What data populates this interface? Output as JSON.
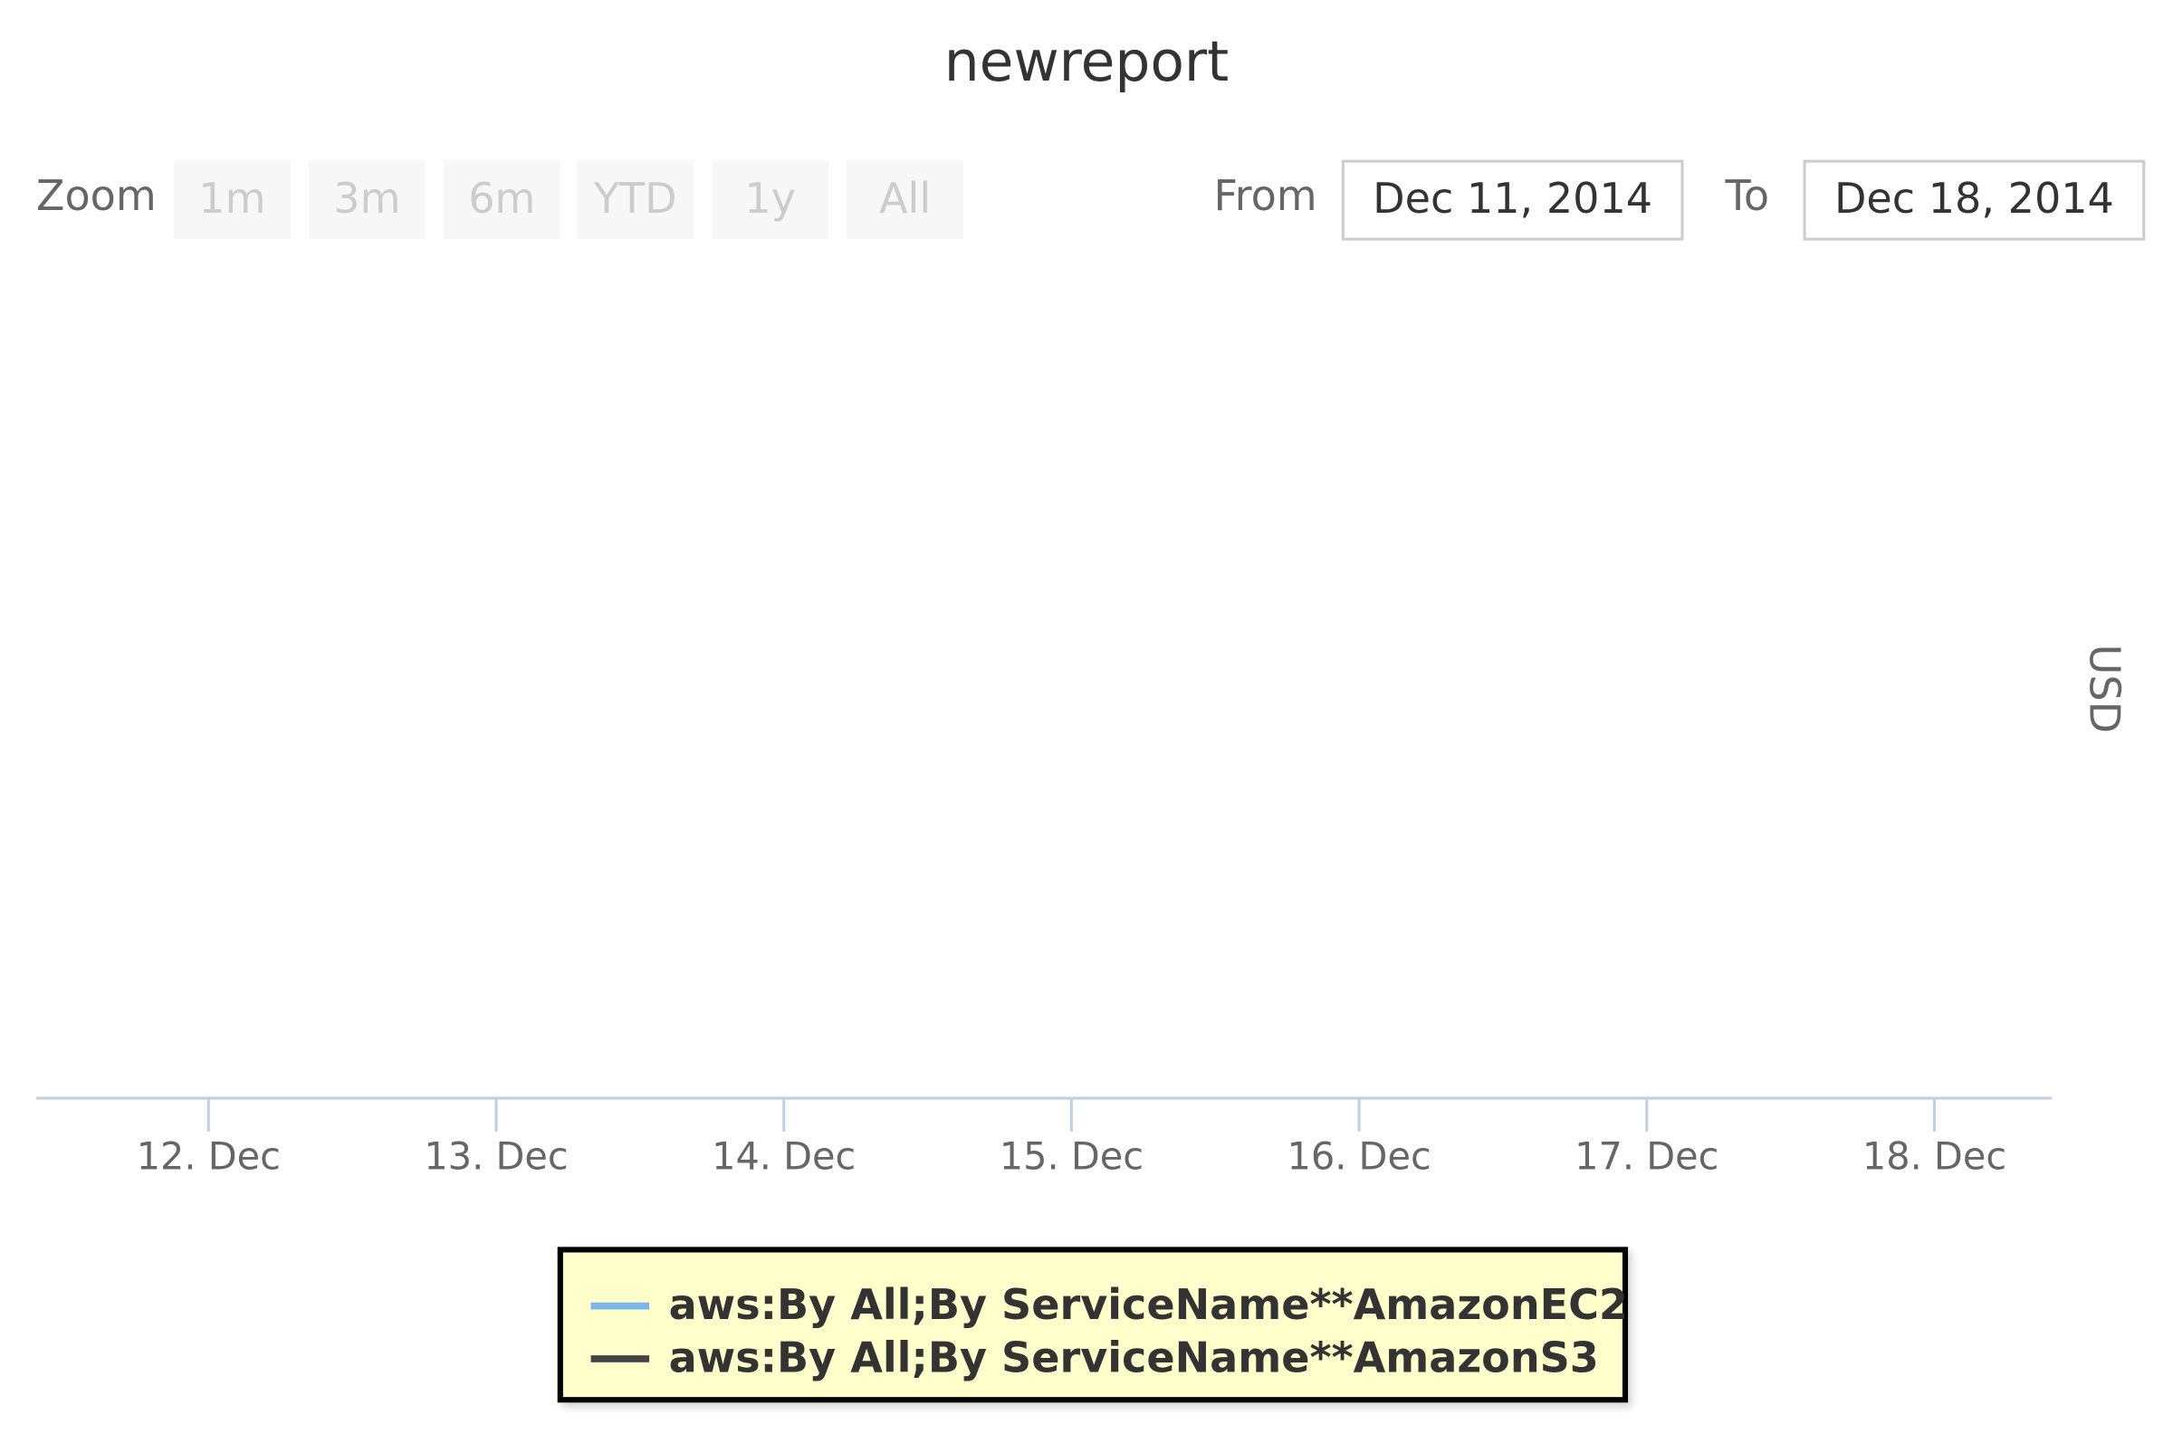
{
  "chart_data": {
    "type": "line",
    "title": "newreport",
    "xlabel": "",
    "ylabel": "USD",
    "x_ticks": [
      "12. Dec",
      "13. Dec",
      "14. Dec",
      "15. Dec",
      "16. Dec",
      "17. Dec",
      "18. Dec"
    ],
    "x_range": [
      "Dec 11, 2014",
      "Dec 18, 2014"
    ],
    "grid": false,
    "legend_position": "bottom-center",
    "series": [
      {
        "name": "aws:By All;By ServiceName**AmazonEC2",
        "color": "#7cb5ec",
        "values": []
      },
      {
        "name": "aws:By All;By ServiceName**AmazonS3",
        "color": "#434348",
        "values": []
      }
    ]
  },
  "range_selector": {
    "zoom_label": "Zoom",
    "buttons": [
      "1m",
      "3m",
      "6m",
      "YTD",
      "1y",
      "All"
    ],
    "from_label": "From",
    "from_value": "Dec 11, 2014",
    "to_label": "To",
    "to_value": "Dec 18, 2014"
  },
  "colors": {
    "axis": "#c0d0e0",
    "legend_background": "#ffffcc",
    "button_background": "#f7f7f7",
    "button_text": "#cccccc"
  }
}
